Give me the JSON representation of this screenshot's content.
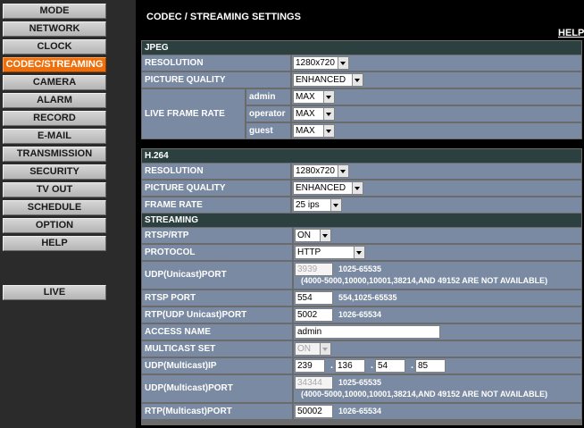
{
  "nav": {
    "items": [
      "MODE",
      "NETWORK",
      "CLOCK",
      "CODEC/STREAMING",
      "CAMERA",
      "ALARM",
      "RECORD",
      "E-MAIL",
      "TRANSMISSION",
      "SECURITY",
      "TV OUT",
      "SCHEDULE",
      "OPTION",
      "HELP"
    ],
    "active": "CODEC/STREAMING",
    "live": "LIVE",
    "active_color": "#ef6f0c"
  },
  "header": {
    "title": "CODEC / STREAMING SETTINGS",
    "help": "HELP"
  },
  "jpeg": {
    "title": "JPEG",
    "resolution_label": "RESOLUTION",
    "resolution_value": "1280x720",
    "quality_label": "PICTURE QUALITY",
    "quality_value": "ENHANCED",
    "frame_rate_label": "LIVE FRAME RATE",
    "users": [
      {
        "name": "admin",
        "value": "MAX"
      },
      {
        "name": "operator",
        "value": "MAX"
      },
      {
        "name": "guest",
        "value": "MAX"
      }
    ]
  },
  "h264": {
    "title": "H.264",
    "resolution_label": "RESOLUTION",
    "resolution_value": "1280x720",
    "quality_label": "PICTURE QUALITY",
    "quality_value": "ENHANCED",
    "frame_rate_label": "FRAME RATE",
    "frame_rate_value": "25 ips"
  },
  "streaming": {
    "title": "STREAMING",
    "rtsp_label": "RTSP/RTP",
    "rtsp_value": "ON",
    "protocol_label": "PROTOCOL",
    "protocol_value": "HTTP",
    "udp_unicast_label": "UDP(Unicast)PORT",
    "udp_unicast_value": "3939",
    "udp_unicast_range": "1025-65535",
    "udp_unicast_note": "(4000-5000,10000,10001,38214,AND 49152 ARE NOT AVAILABLE)",
    "rtsp_port_label": "RTSP PORT",
    "rtsp_port_value": "554",
    "rtsp_port_range": "554,1025-65535",
    "rtp_unicast_label": "RTP(UDP Unicast)PORT",
    "rtp_unicast_value": "5002",
    "rtp_unicast_range": "1026-65534",
    "access_name_label": "ACCESS NAME",
    "access_name_value": "admin",
    "multicast_set_label": "MULTICAST SET",
    "multicast_set_value": "ON",
    "udp_multicast_ip_label": "UDP(Multicast)IP",
    "udp_multicast_ip": [
      "239",
      "136",
      "54",
      "85"
    ],
    "udp_multicast_port_label": "UDP(Multicast)PORT",
    "udp_multicast_port_value": "34344",
    "udp_multicast_port_range": "1025-65535",
    "udp_multicast_port_note": "(4000-5000,10000,10001,38214,AND 49152 ARE NOT AVAILABLE)",
    "rtp_multicast_label": "RTP(Multicast)PORT",
    "rtp_multicast_value": "50002",
    "rtp_multicast_range": "1026-65534",
    "ip_separator": "."
  }
}
